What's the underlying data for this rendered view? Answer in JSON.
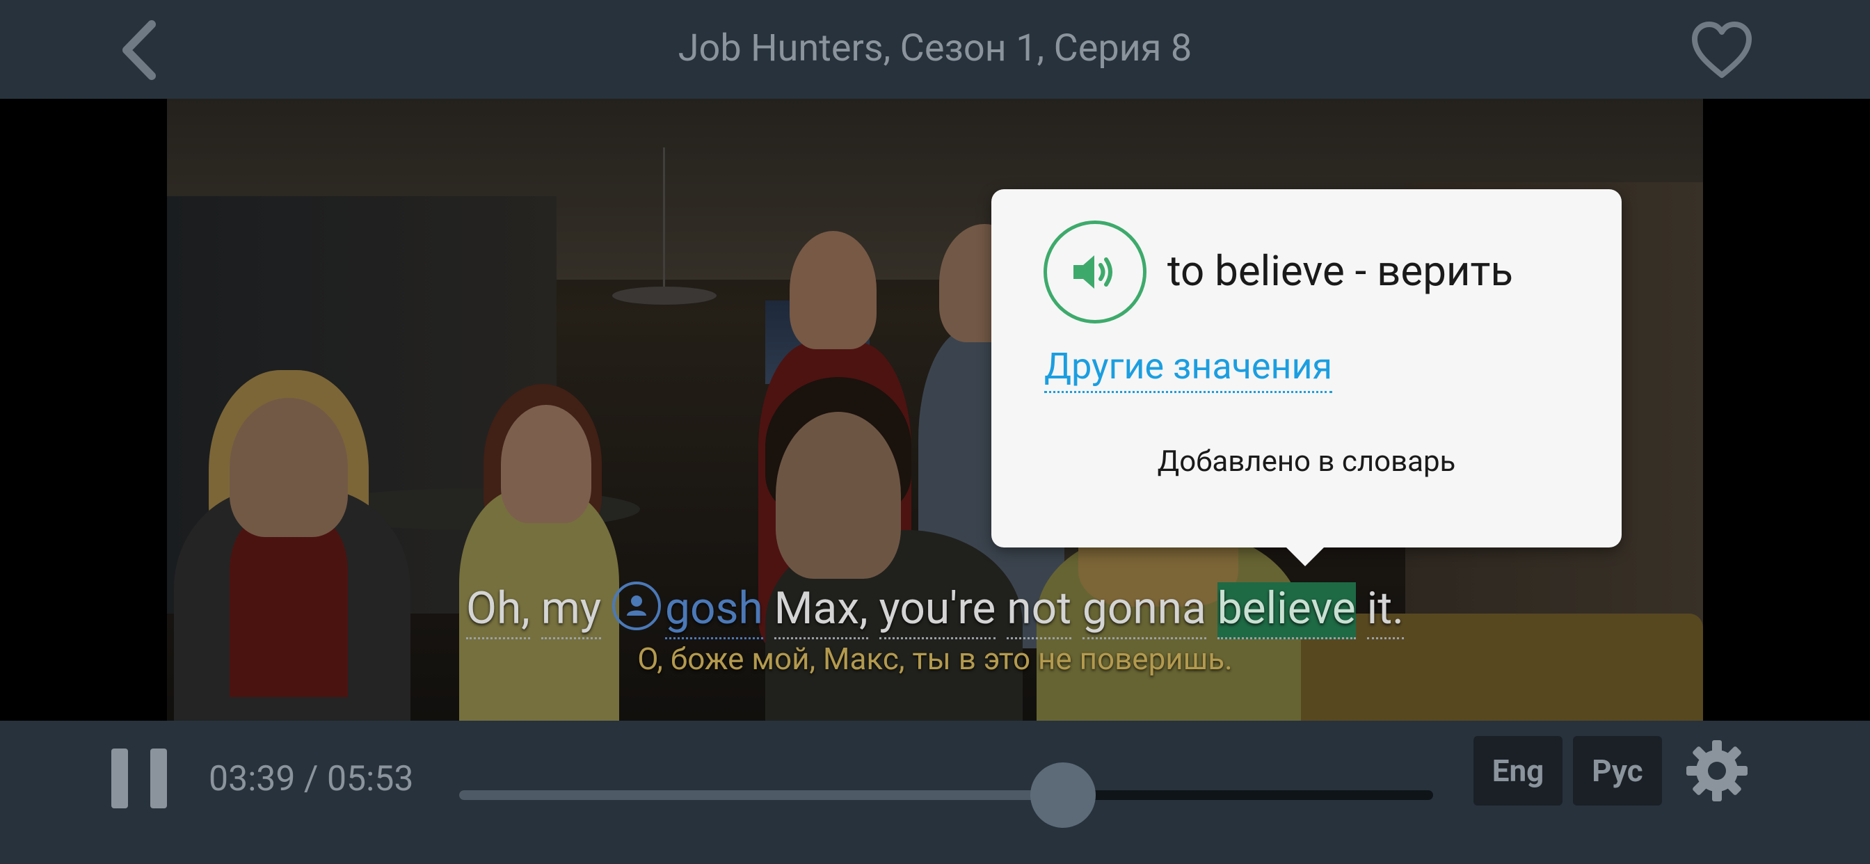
{
  "header": {
    "title": "Job Hunters, Сезон 1, Серия 8",
    "back_icon": "chevron-left-icon",
    "favorite_icon": "heart-outline-icon"
  },
  "subtitles": {
    "english_words": [
      "Oh,",
      "my",
      "gosh",
      "Max,",
      "you're",
      "not",
      "gonna",
      "believe",
      "it."
    ],
    "known_word": "gosh",
    "selected_word": "believe",
    "russian": "О, боже мой, Макс, ты в это не поверишь."
  },
  "popup": {
    "speaker_icon": "speaker-icon",
    "translation": "to believe - верить",
    "other_meanings_link": "Другие значения",
    "status": "Добавлено в словарь"
  },
  "controls": {
    "time": "03:39 / 05:53",
    "progress": 0.62,
    "lang_eng": "Eng",
    "lang_rus": "Рус",
    "settings_icon": "gear-icon",
    "pause_icon": "pause-icon"
  },
  "colors": {
    "background": "#27323c",
    "accent_green": "#3daa6b",
    "link_blue": "#1b9ee0",
    "known_word_blue": "#4b79b8",
    "russian_subtitle": "#b49a4e"
  }
}
